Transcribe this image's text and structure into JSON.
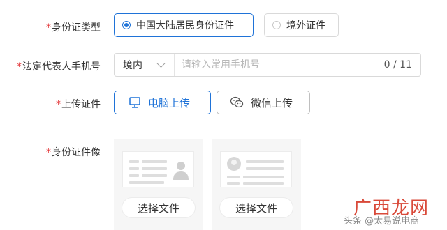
{
  "form": {
    "id_type": {
      "label": "身份证类型",
      "options": [
        {
          "label": "中国大陆居民身份证件",
          "selected": true
        },
        {
          "label": "境外证件",
          "selected": false
        }
      ]
    },
    "phone": {
      "label": "法定代表人手机号",
      "region": "境内",
      "placeholder": "请输入常用手机号",
      "counter": "0 / 11"
    },
    "upload": {
      "label": "上传证件",
      "pc_button": "电脑上传",
      "wechat_button": "微信上传"
    },
    "id_images": {
      "label": "身份证件像",
      "choose_button_1": "选择文件",
      "choose_button_2": "选择文件"
    }
  },
  "required_mark": "*",
  "watermark": {
    "logo": "广西龙网",
    "sub": "头条 @太易说电商"
  },
  "colors": {
    "accent": "#1f73d8",
    "required": "#e4393c",
    "border": "#d9d9d9"
  },
  "icons": [
    "radio-dot-icon",
    "chevron-down-icon",
    "monitor-icon",
    "wechat-icon",
    "avatar-placeholder-icon"
  ]
}
